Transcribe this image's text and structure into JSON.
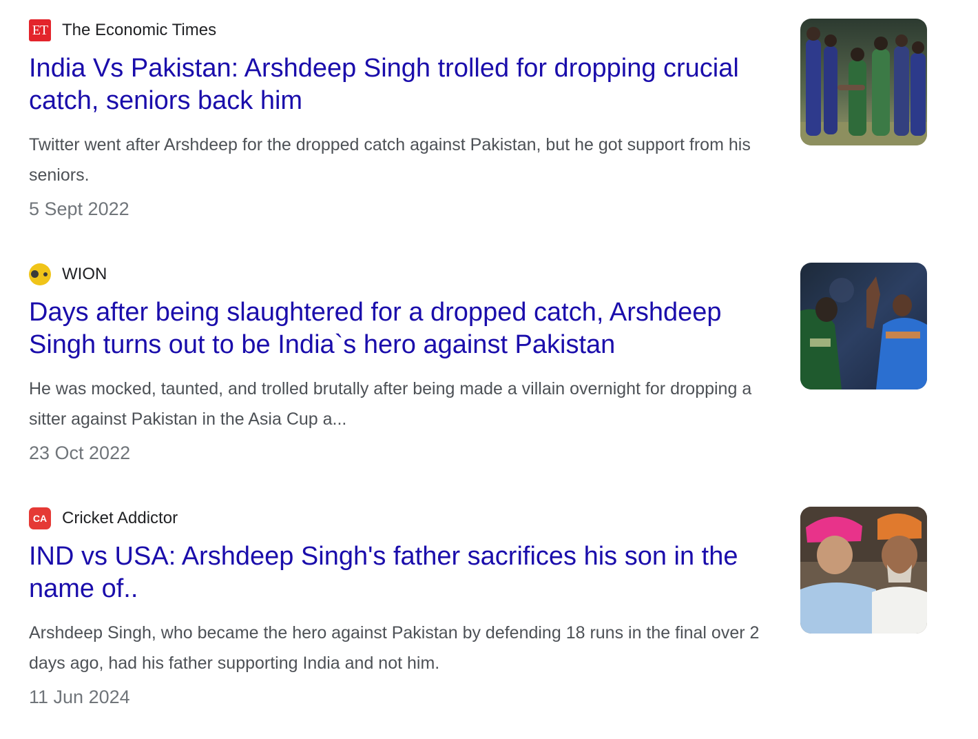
{
  "results": [
    {
      "source": "The Economic Times",
      "favicon_text": "ET",
      "favicon_icon": "economic-times-logo",
      "headline": "India Vs Pakistan: Arshdeep Singh trolled for dropping crucial catch, seniors back him",
      "snippet": "Twitter went after Arshdeep for the dropped catch against Pakistan, but he got support from his seniors.",
      "date": "5 Sept 2022",
      "thumbnail": "cricket-players-handshake-photo"
    },
    {
      "source": "WION",
      "favicon_icon": "wion-logo",
      "headline": "Days after being slaughtered for a dropped catch, Arshdeep Singh turns out to be India`s hero against Pakistan",
      "snippet": "He was mocked, taunted, and trolled brutally after being made a villain overnight for dropping a sitter against Pakistan in the Asia Cup a...",
      "date": "23 Oct 2022",
      "thumbnail": "cricket-player-celebrating-photo"
    },
    {
      "source": "Cricket Addictor",
      "favicon_text": "CA",
      "favicon_icon": "cricket-addictor-logo",
      "headline": "IND vs USA: Arshdeep Singh's father sacrifices his son in the name of..",
      "snippet": "Arshdeep Singh, who became the hero against Pakistan by defending 18 runs in the final over 2 days ago, had his father supporting India and not him.",
      "date": "11 Jun 2024",
      "thumbnail": "father-and-son-turbans-photo"
    }
  ],
  "colors": {
    "headline_link": "#1a0dab",
    "snippet_text": "#4d5156",
    "date_text": "#70757a",
    "source_text": "#202124",
    "et_red": "#e3242b",
    "wion_yellow": "#f0c419",
    "ca_red": "#e53935"
  }
}
